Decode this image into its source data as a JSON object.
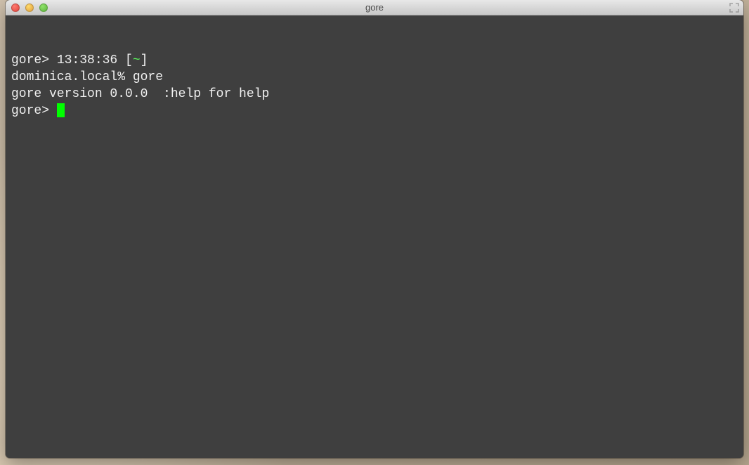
{
  "window": {
    "title": "gore"
  },
  "terminal": {
    "line1_prompt": "gore> ",
    "line1_time": "13:38:36 ",
    "line1_path_open": "[",
    "line1_path_tilde": "~",
    "line1_path_close": "]",
    "line2_host": "dominica.local% ",
    "line2_cmd": "gore",
    "line3": "gore version 0.0.0  :help for help",
    "line4_prompt": "gore> "
  },
  "colors": {
    "terminal_bg": "#3f3f3f",
    "terminal_fg": "#f0f0f0",
    "accent_green": "#5af25a",
    "cursor": "#00ff00"
  }
}
